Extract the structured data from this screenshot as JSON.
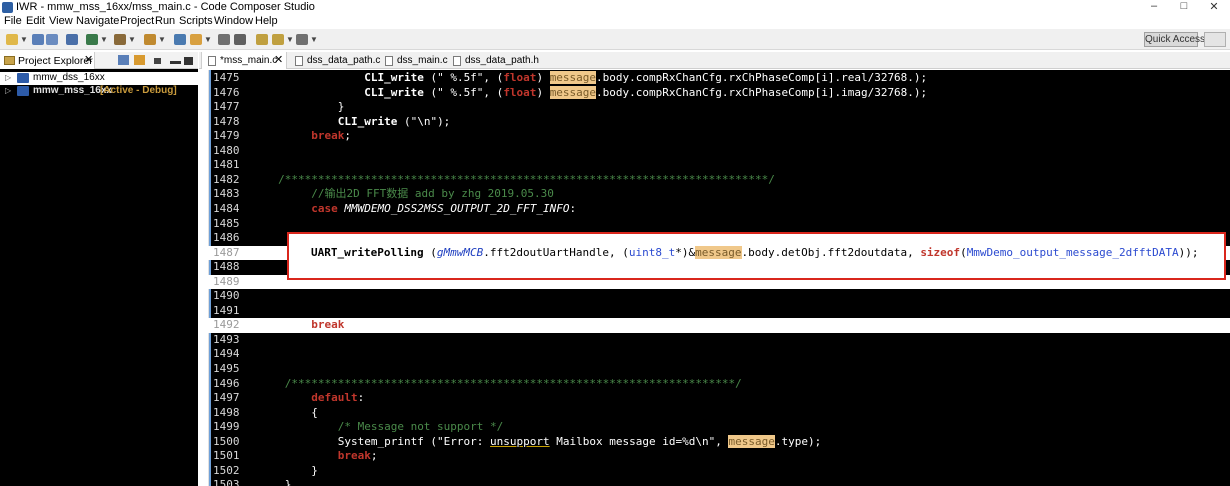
{
  "window": {
    "title": "IWR - mmw_mss_16xx/mss_main.c - Code Composer Studio",
    "controls": [
      "–",
      "□",
      "✕"
    ]
  },
  "menu": [
    "File",
    "Edit",
    "View",
    "Navigate",
    "Project",
    "Run",
    "Scripts",
    "Window",
    "Help"
  ],
  "toolbar": {
    "quick_access": "Quick Access"
  },
  "project_explorer": {
    "tab_label": "Project Explorer",
    "close_glyph": "✕",
    "items": [
      {
        "name": "mmw_dss_16xx",
        "extra": ""
      },
      {
        "name": "mmw_mss_16xx",
        "extra": "[Active - Debug]"
      }
    ]
  },
  "editor_tabs": [
    {
      "label": "*mss_main.c",
      "active": true,
      "close_glyph": "✕"
    },
    {
      "label": "dss_data_path.c",
      "active": false
    },
    {
      "label": "dss_main.c",
      "active": false
    },
    {
      "label": "dss_data_path.h",
      "active": false
    }
  ],
  "code": {
    "lines": [
      {
        "n": "1475",
        "parts": [
          [
            "ind",
            "                  "
          ],
          [
            "fn",
            "CLI_write"
          ],
          [
            "t",
            " (\" %.5f\", ("
          ],
          [
            "k",
            "float"
          ],
          [
            "t",
            ") "
          ],
          [
            "m",
            "message"
          ],
          [
            "t",
            ".body.compRxChanCfg.rxChPhaseComp[i].real/32768.);"
          ]
        ]
      },
      {
        "n": "1476",
        "parts": [
          [
            "ind",
            "                  "
          ],
          [
            "fn",
            "CLI_write"
          ],
          [
            "t",
            " (\" %.5f\", ("
          ],
          [
            "k",
            "float"
          ],
          [
            "t",
            ") "
          ],
          [
            "m",
            "message"
          ],
          [
            "t",
            ".body.compRxChanCfg.rxChPhaseComp[i].imag/32768.);"
          ]
        ]
      },
      {
        "n": "1477",
        "parts": [
          [
            "ind",
            "              "
          ],
          [
            "t",
            "}"
          ]
        ]
      },
      {
        "n": "1478",
        "parts": [
          [
            "ind",
            "              "
          ],
          [
            "fn",
            "CLI_write"
          ],
          [
            "t",
            " (\"\\n\");"
          ]
        ]
      },
      {
        "n": "1479",
        "parts": [
          [
            "ind",
            "          "
          ],
          [
            "k",
            "break"
          ],
          [
            "t",
            ";"
          ]
        ]
      },
      {
        "n": "1480",
        "parts": []
      },
      {
        "n": "1481",
        "parts": []
      },
      {
        "n": "1482",
        "parts": [
          [
            "ind",
            "     "
          ],
          [
            "c",
            "/*************************************************************************/"
          ]
        ]
      },
      {
        "n": "1483",
        "parts": [
          [
            "ind",
            "          "
          ],
          [
            "c",
            "//输出2D FFT数据 add by zhg 2019.05.30"
          ]
        ]
      },
      {
        "n": "1484",
        "parts": [
          [
            "ind",
            "          "
          ],
          [
            "k",
            "case"
          ],
          [
            "t",
            " "
          ],
          [
            "i",
            "MMWDEMO_DSS2MSS_OUTPUT_2D_FFT_INFO"
          ],
          [
            "t",
            ":"
          ]
        ]
      },
      {
        "n": "1485",
        "parts": []
      },
      {
        "n": "1486",
        "parts": []
      },
      {
        "n": "1487",
        "parts": []
      },
      {
        "n": "1488",
        "parts": []
      },
      {
        "n": "1489",
        "parts": []
      },
      {
        "n": "1490",
        "parts": []
      },
      {
        "n": "1491",
        "parts": []
      },
      {
        "n": "1492",
        "parts": [
          [
            "ind",
            "          "
          ],
          [
            "k",
            "break"
          ],
          [
            "t",
            ";"
          ]
        ]
      },
      {
        "n": "1493",
        "parts": []
      },
      {
        "n": "1494",
        "parts": []
      },
      {
        "n": "1495",
        "parts": []
      },
      {
        "n": "1496",
        "parts": [
          [
            "ind",
            "      "
          ],
          [
            "c",
            "/*******************************************************************/"
          ]
        ]
      },
      {
        "n": "1497",
        "parts": [
          [
            "ind",
            "          "
          ],
          [
            "k",
            "default"
          ],
          [
            "t",
            ":"
          ]
        ]
      },
      {
        "n": "1498",
        "parts": [
          [
            "ind",
            "          "
          ],
          [
            "t",
            "{"
          ]
        ]
      },
      {
        "n": "1499",
        "parts": [
          [
            "ind",
            "              "
          ],
          [
            "c",
            "/* Message not support */"
          ]
        ]
      },
      {
        "n": "1500",
        "parts": [
          [
            "ind",
            "              "
          ],
          [
            "t",
            "System_printf (\"Error: "
          ],
          [
            "u",
            "unsupport"
          ],
          [
            "t",
            " Mailbox message id=%d\\n\", "
          ],
          [
            "m",
            "message"
          ],
          [
            "t",
            ".type);"
          ]
        ]
      },
      {
        "n": "1501",
        "parts": [
          [
            "ind",
            "              "
          ],
          [
            "k",
            "break"
          ],
          [
            "t",
            ";"
          ]
        ]
      },
      {
        "n": "1502",
        "parts": [
          [
            "ind",
            "          "
          ],
          [
            "t",
            "}"
          ]
        ]
      },
      {
        "n": "1503",
        "parts": [
          [
            "ind",
            "      "
          ],
          [
            "t",
            "}"
          ]
        ]
      }
    ],
    "callout": {
      "fn": "UART_writePolling",
      "open": " (",
      "gvar": "gMmwMCB",
      "t1": ".fft2doutUartHandle, (",
      "type1": "uint8_t",
      "t2": "*)&",
      "msg": "message",
      "t3": ".body.detObj.fft2doutdata, ",
      "kw": "sizeof",
      "t4": "(",
      "type2": "MmwDemo_output_message_2dfftDATA",
      "t5": "));"
    }
  },
  "colors": {
    "callout_border": "#d9261c",
    "highlight_message": "#f0c88a"
  }
}
